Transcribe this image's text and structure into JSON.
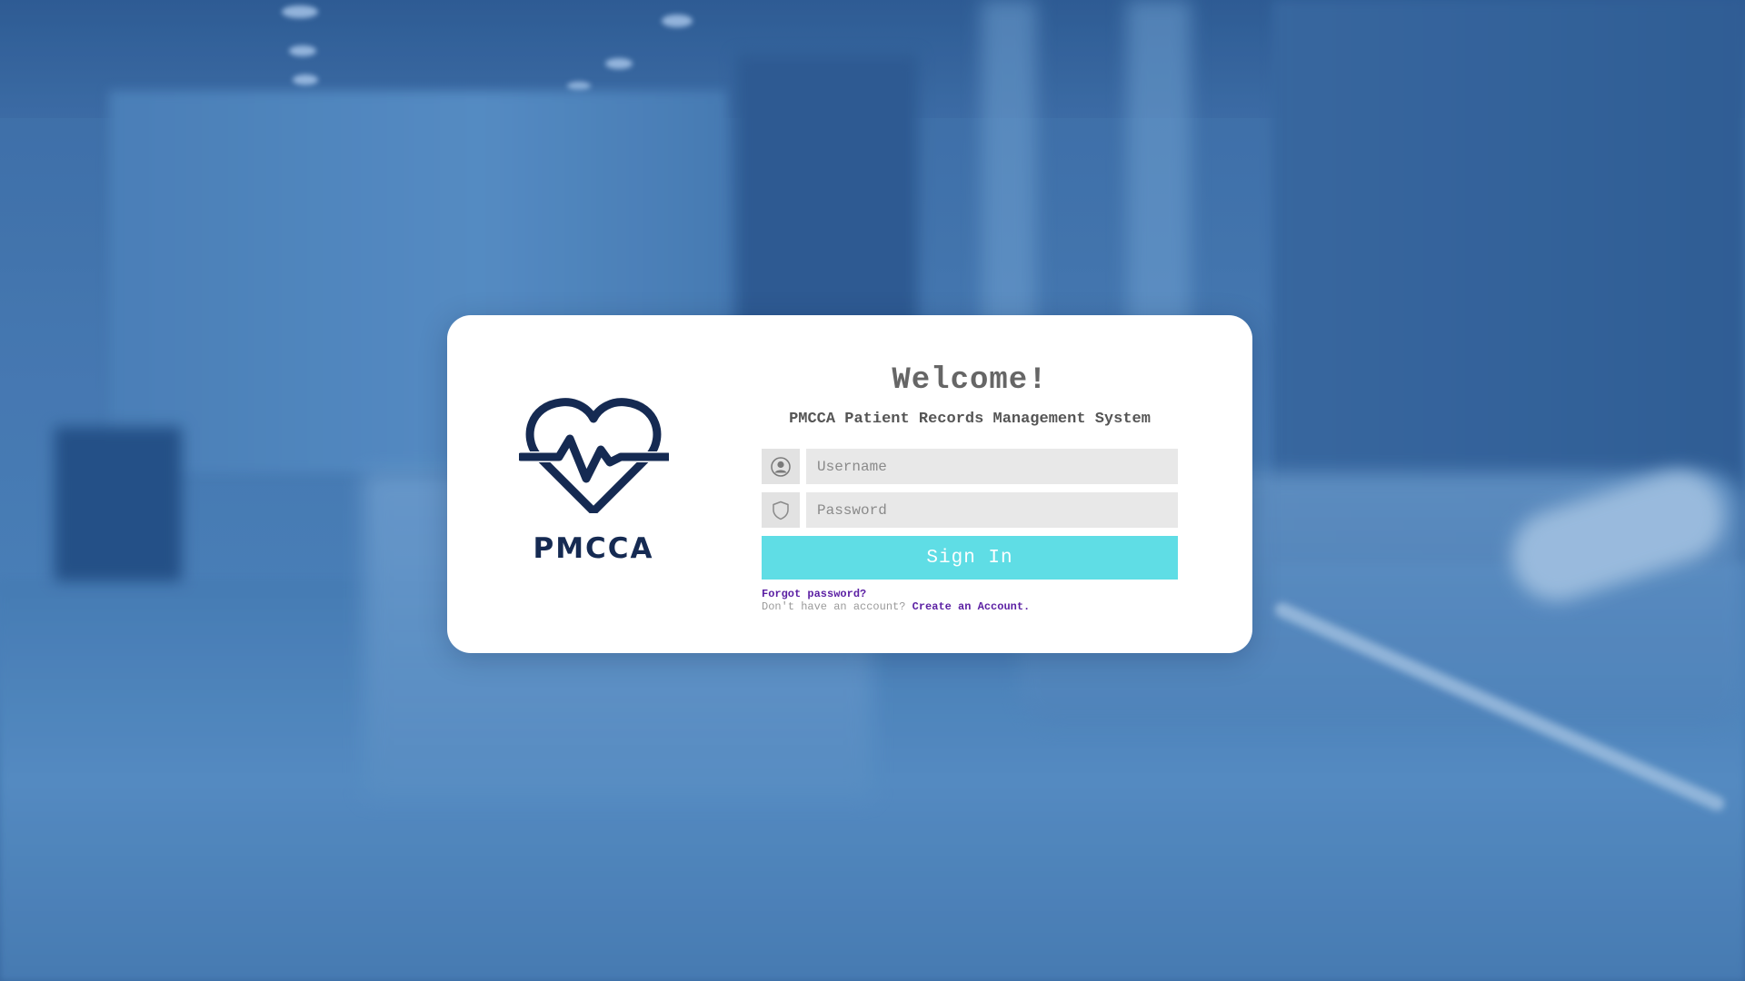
{
  "brand": {
    "name": "PMCCA",
    "primary_color": "#152a52",
    "logo_icon": "heart-pulse-icon"
  },
  "login": {
    "title": "Welcome!",
    "subtitle": "PMCCA Patient Records Management System",
    "username_placeholder": "Username",
    "username_value": "",
    "username_icon": "user-icon",
    "password_placeholder": "Password",
    "password_value": "",
    "password_icon": "shield-icon",
    "signin_label": "Sign In",
    "signin_color": "#5fdde5",
    "forgot_label": "Forgot password?",
    "no_account_text": "Don't have an account?",
    "create_account_label": "Create an Account.",
    "link_color": "#5b1fa3"
  }
}
